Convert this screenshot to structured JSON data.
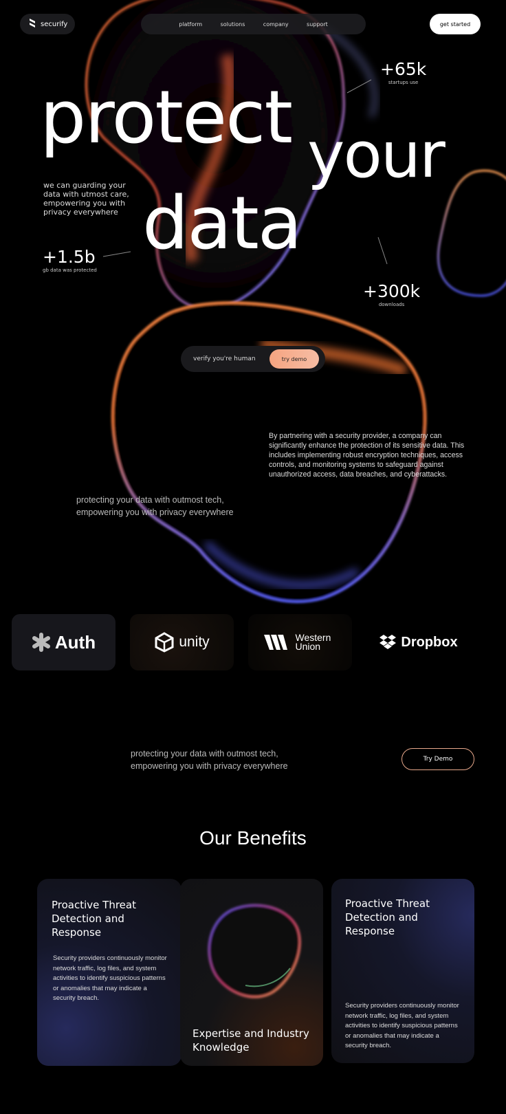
{
  "header": {
    "brand": "securify",
    "nav": [
      "platform",
      "solutions",
      "company",
      "support"
    ],
    "cta": "get started"
  },
  "hero": {
    "word1": "protect",
    "word2": "your",
    "word3": "data",
    "tagline": "we can guarding your data with utmost care, empowering you with privacy everywhere",
    "stats": [
      {
        "value": "+65k",
        "label": "startups use"
      },
      {
        "value": "+1.5b",
        "label": "gb data was protected"
      },
      {
        "value": "+300k",
        "label": "downloads"
      }
    ],
    "verify_label": "verify you're human",
    "verify_button": "try demo"
  },
  "about": {
    "paragraph": "By partnering with a security provider, a company can significantly enhance the protection of its sensitive data. This includes implementing robust encryption techniques, access controls, and monitoring systems to safeguard against unauthorized access, data breaches, and cyberattacks.",
    "tagline": "protecting your data with outmost tech, empowering you with privacy everywhere"
  },
  "partners": [
    "Auth",
    "unity",
    "Western Union",
    "Dropbox"
  ],
  "cta_band": {
    "text": "protecting your data with outmost tech, empowering you with privacy everywhere",
    "button": "Try Demo"
  },
  "benefits": {
    "title": "Our Benefits",
    "cards": [
      {
        "title": "Proactive Threat Detection and Response",
        "body": "Security providers  continuously monitor network traffic, log files, and system activities to identify suspicious patterns or anomalies that may indicate a security breach."
      },
      {
        "title": "Expertise and Industry Knowledge"
      },
      {
        "title": "Proactive Threat Detection and Response",
        "body": "Security providers  continuously monitor network traffic, log files, and system activities to identify suspicious patterns or anomalies that may indicate a security breach."
      }
    ]
  },
  "colors": {
    "accent_orange": "#f5a481",
    "accent_blue": "#5a63ff",
    "background": "#000000"
  }
}
